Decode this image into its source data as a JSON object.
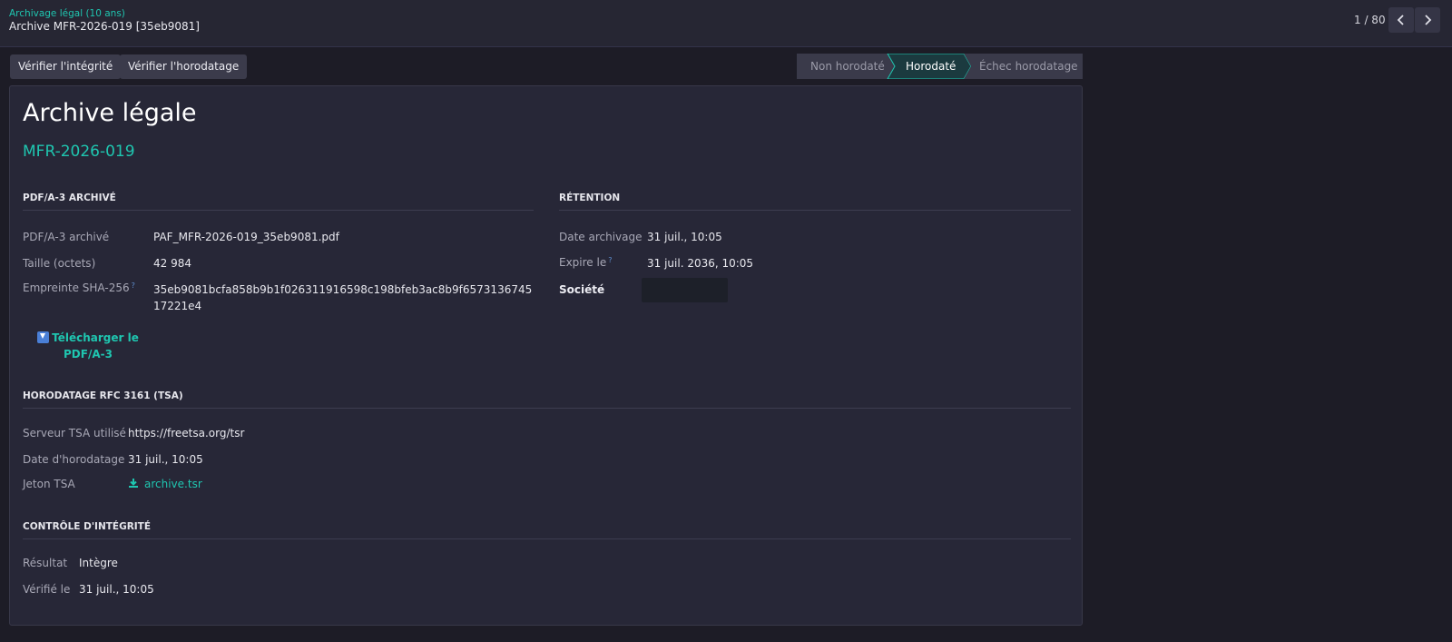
{
  "breadcrumb": {
    "parent": "Archivage légal (10 ans)",
    "current": "Archive MFR-2026-019 [35eb9081]"
  },
  "pager": {
    "text": "1 / 80"
  },
  "actions": {
    "verify_integrity": "Vérifier l'intégrité",
    "verify_timestamp": "Vérifier l'horodatage"
  },
  "status": {
    "stages": [
      "Non horodaté",
      "Horodaté",
      "Échec horodatage"
    ],
    "active": "Horodaté",
    "accent": "#1fc6b0"
  },
  "sheet": {
    "title": "Archive légale",
    "reference": "MFR-2026-019"
  },
  "pdf_section": {
    "title": "PDF/A-3 ARCHIVÉ",
    "fields": [
      {
        "label": "PDF/A-3 archivé",
        "value": "PAF_MFR-2026-019_35eb9081.pdf"
      },
      {
        "label": "Taille (octets)",
        "value": "42 984"
      },
      {
        "label": "Empreinte SHA-256",
        "help": "?",
        "value": "35eb9081bcfa858b9b1f026311916598c198bfeb3ac8b9f657313674517221e4"
      }
    ],
    "download_label": "Télécharger le PDF/A-3"
  },
  "retention_section": {
    "title": "RÉTENTION",
    "fields": [
      {
        "label": "Date archivage",
        "value": "31 juil., 10:05"
      },
      {
        "label": "Expire le",
        "help": "?",
        "value": "31 juil. 2036, 10:05"
      },
      {
        "label": "Société",
        "value": ""
      }
    ]
  },
  "tsa_section": {
    "title": "HORODATAGE RFC 3161 (TSA)",
    "fields": [
      {
        "label": "Serveur TSA utilisé",
        "value": "https://freetsa.org/tsr"
      },
      {
        "label": "Date d'horodatage",
        "value": "31 juil., 10:05"
      },
      {
        "label": "Jeton TSA",
        "value": "archive.tsr"
      }
    ]
  },
  "integrity_section": {
    "title": "CONTRÔLE D'INTÉGRITÉ",
    "fields": [
      {
        "label": "Résultat",
        "value": "Intègre"
      },
      {
        "label": "Vérifié le",
        "value": "31 juil., 10:05"
      }
    ]
  }
}
